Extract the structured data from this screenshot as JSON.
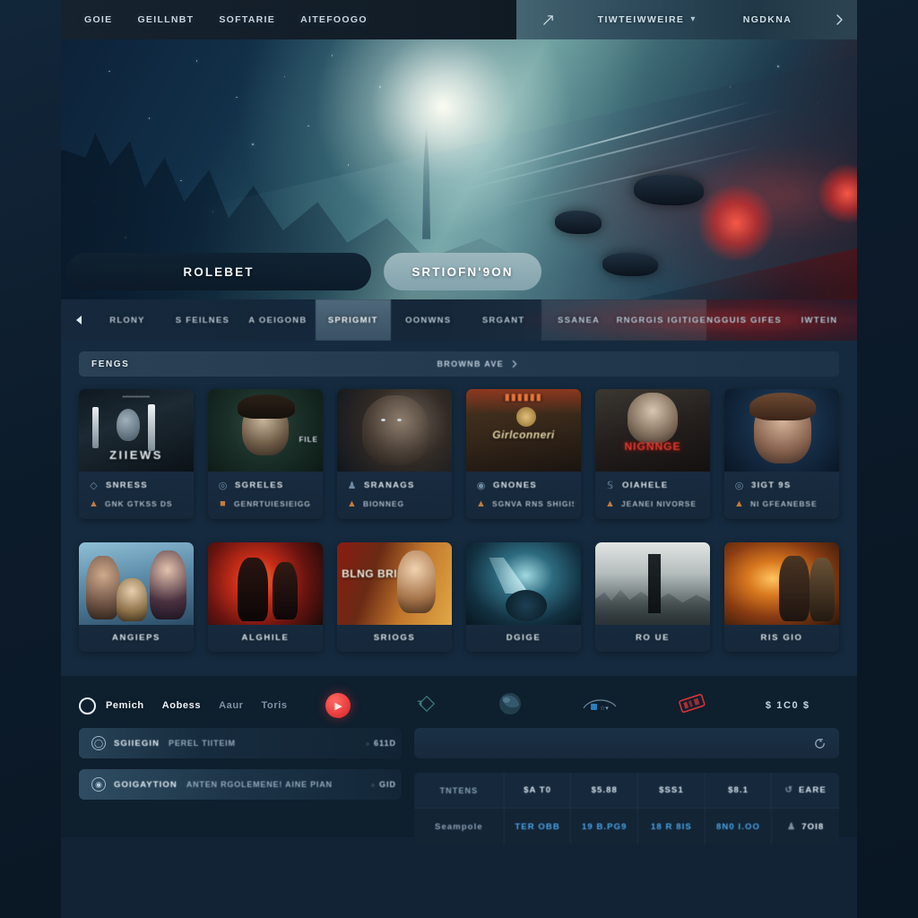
{
  "topnav": {
    "left_items": [
      {
        "label": "GOIE"
      },
      {
        "label": "GEILLNBT"
      },
      {
        "label": "SOFTARIE"
      },
      {
        "label": "AITEFOOGO"
      }
    ],
    "right": {
      "icon": "rising-arrow-icon",
      "dropdown_label": "TIWTEIWWEIRE",
      "dropdown_chevron": "chevron-down-icon",
      "account_label": "NGDKNA",
      "next_chevron": "chevron-right-icon"
    }
  },
  "hero": {
    "primary_button": "ROLEBET",
    "secondary_button": "SRTIOFN'9ON"
  },
  "categories": {
    "back_icon": "back-triangle-icon",
    "items": [
      {
        "label": "RLONY",
        "state": "normal"
      },
      {
        "label": "S FEILNES",
        "state": "normal"
      },
      {
        "label": "A OEIGONB",
        "state": "normal"
      },
      {
        "label": "SPRIGMIT",
        "state": "active"
      },
      {
        "label": "OONWNS",
        "state": "normal"
      },
      {
        "label": "SRGANT",
        "state": "normal"
      },
      {
        "label": "SSANEA",
        "state": "glass"
      },
      {
        "label": "RNGRGIS IGITIGE",
        "state": "glass"
      },
      {
        "label": "NGGUIS GIFES",
        "state": "normal"
      },
      {
        "label": "IWTEIN",
        "state": "normal"
      }
    ]
  },
  "section": {
    "title": "FENGS",
    "more_label": "BROWNB AVE",
    "more_icon": "chevron-right-icon"
  },
  "row1_cards": [
    {
      "title": "SNRESS",
      "subtitle": "GNK GTKSS DS",
      "sub_icon": "warning-triangle-icon",
      "title_icon": "diamond-icon",
      "poster_text": "ZIIEWS",
      "poster_theme": "cave-dark"
    },
    {
      "title": "SGRELES",
      "subtitle": "GENRTUIESIEIGG",
      "sub_icon": "flag-icon",
      "title_icon": "circle-icon",
      "poster_text": "FILE",
      "poster_theme": "green-portrait"
    },
    {
      "title": "SRANAGS",
      "subtitle": "BIONNEG",
      "sub_icon": "people-icon",
      "title_icon": "person-icon",
      "poster_text": "",
      "poster_theme": "dark-face"
    },
    {
      "title": "GNONES",
      "subtitle": "SGNVA RNS SHIGIS",
      "sub_icon": "warning-triangle-icon",
      "title_icon": "coin-icon",
      "poster_text": "Girlconneri",
      "poster_theme": "gold-ornate"
    },
    {
      "title": "OIAHELE",
      "subtitle": "JEANEI NIVORSE",
      "sub_icon": "warning-triangle-icon",
      "title_icon": "s-icon",
      "poster_text": "NIGNNGE",
      "poster_theme": "red-horror"
    },
    {
      "title": "3IGT 9S",
      "subtitle": "NI GFEANEBSE",
      "sub_icon": "warning-triangle-icon",
      "title_icon": "circle-icon",
      "poster_text": "",
      "poster_theme": "blue-portrait"
    }
  ],
  "row2_cards": [
    {
      "title": "ANGIEPS",
      "poster_theme": "family-blue"
    },
    {
      "title": "ALGHILE",
      "poster_theme": "fire-red"
    },
    {
      "title": "SRIOGS",
      "poster_text": "BLNG BRIC",
      "poster_theme": "orange-poster"
    },
    {
      "title": "DGIGE",
      "poster_theme": "teal-tunnel"
    },
    {
      "title": "RO UE",
      "poster_theme": "city-ruins"
    },
    {
      "title": "RIS GIO",
      "poster_theme": "amber-warm"
    }
  ],
  "bottom": {
    "radio_icon": "radio-circle-icon",
    "links": [
      {
        "label": "Pemich",
        "state": "on"
      },
      {
        "label": "Aobess",
        "state": "on"
      },
      {
        "label": "Aaur",
        "state": "off"
      },
      {
        "label": "Toris",
        "state": "off"
      }
    ],
    "play_icon": "play-icon",
    "deco_icons": [
      {
        "name": "gem-outline-icon"
      },
      {
        "name": "sphere-icon"
      },
      {
        "name": "arc-gauge-icon"
      },
      {
        "name": "red-ticket-icon"
      }
    ],
    "price": "$ 1C0 $",
    "list_rows": [
      {
        "icon": "clock-icon",
        "name": "SGIIEGIN",
        "desc": "PEREL TIITEIM",
        "value": "611D"
      },
      {
        "icon": "globe-icon",
        "name": "GOIGAYTION",
        "desc": "ANTEN  RGOLEMENE! AINE PIAN",
        "value": "GID"
      }
    ],
    "search_placeholder": "",
    "search_value": "",
    "reload_icon": "reload-icon"
  },
  "table": {
    "rows": [
      {
        "cells": [
          {
            "text": "TNTENS",
            "kind": "label"
          },
          {
            "text": "$A T0",
            "kind": "value"
          },
          {
            "text": "$5.88",
            "kind": "value"
          },
          {
            "text": "$SS1",
            "kind": "value"
          },
          {
            "text": "$8.1",
            "kind": "value"
          },
          {
            "text": "EARE",
            "kind": "value",
            "icon": "refresh-icon"
          }
        ]
      },
      {
        "cells": [
          {
            "text": "Seampole",
            "kind": "label"
          },
          {
            "text": "TER OBB",
            "kind": "value"
          },
          {
            "text": "19 B.PG9",
            "kind": "value"
          },
          {
            "text": "18 R 8IS",
            "kind": "value"
          },
          {
            "text": "8N0 I.OO",
            "kind": "value"
          },
          {
            "text": "7OI8",
            "kind": "white",
            "icon": "user-icon"
          }
        ]
      }
    ]
  },
  "colors": {
    "accent_red": "#e83b3b",
    "accent_blue": "#4ba6e8",
    "accent_orange": "#e08a3a",
    "panel": "#152a3e",
    "bottom_panel": "#0e1f2e"
  }
}
